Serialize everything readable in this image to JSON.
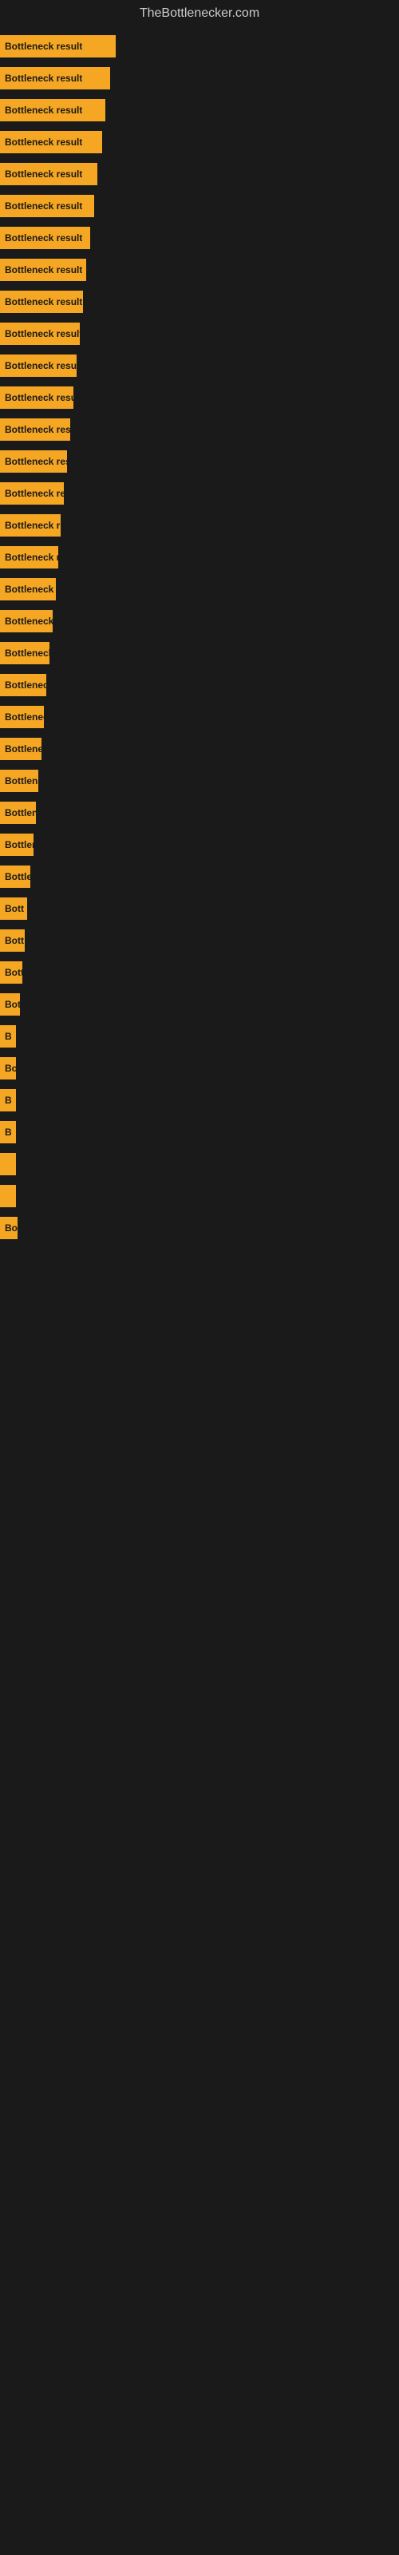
{
  "site": {
    "title": "TheBottlenecker.com"
  },
  "bars": [
    {
      "label": "Bottleneck result",
      "width": 145
    },
    {
      "label": "Bottleneck result",
      "width": 138
    },
    {
      "label": "Bottleneck result",
      "width": 132
    },
    {
      "label": "Bottleneck result",
      "width": 128
    },
    {
      "label": "Bottleneck result",
      "width": 122
    },
    {
      "label": "Bottleneck result",
      "width": 118
    },
    {
      "label": "Bottleneck result",
      "width": 113
    },
    {
      "label": "Bottleneck result",
      "width": 108
    },
    {
      "label": "Bottleneck result",
      "width": 104
    },
    {
      "label": "Bottleneck result",
      "width": 100
    },
    {
      "label": "Bottleneck result",
      "width": 96
    },
    {
      "label": "Bottleneck result",
      "width": 92
    },
    {
      "label": "Bottleneck result",
      "width": 88
    },
    {
      "label": "Bottleneck result",
      "width": 84
    },
    {
      "label": "Bottleneck result",
      "width": 80
    },
    {
      "label": "Bottleneck result",
      "width": 76
    },
    {
      "label": "Bottleneck result",
      "width": 73
    },
    {
      "label": "Bottleneck result",
      "width": 70
    },
    {
      "label": "Bottleneck resu",
      "width": 66
    },
    {
      "label": "Bottleneck r",
      "width": 62
    },
    {
      "label": "Bottleneck resu",
      "width": 58
    },
    {
      "label": "Bottleneck res",
      "width": 55
    },
    {
      "label": "Bottleneck result",
      "width": 52
    },
    {
      "label": "Bottleneck",
      "width": 48
    },
    {
      "label": "Bottleneck resu",
      "width": 45
    },
    {
      "label": "Bottlen",
      "width": 42
    },
    {
      "label": "Bottle",
      "width": 38
    },
    {
      "label": "Bott",
      "width": 34
    },
    {
      "label": "Bott",
      "width": 31
    },
    {
      "label": "Bottlen",
      "width": 28
    },
    {
      "label": "Bot",
      "width": 25
    },
    {
      "label": "B",
      "width": 18
    },
    {
      "label": "Bo",
      "width": 20
    },
    {
      "label": "B",
      "width": 14
    },
    {
      "label": "B",
      "width": 11
    },
    {
      "label": "",
      "width": 8
    },
    {
      "label": "",
      "width": 6
    },
    {
      "label": "Bo",
      "width": 22
    }
  ]
}
